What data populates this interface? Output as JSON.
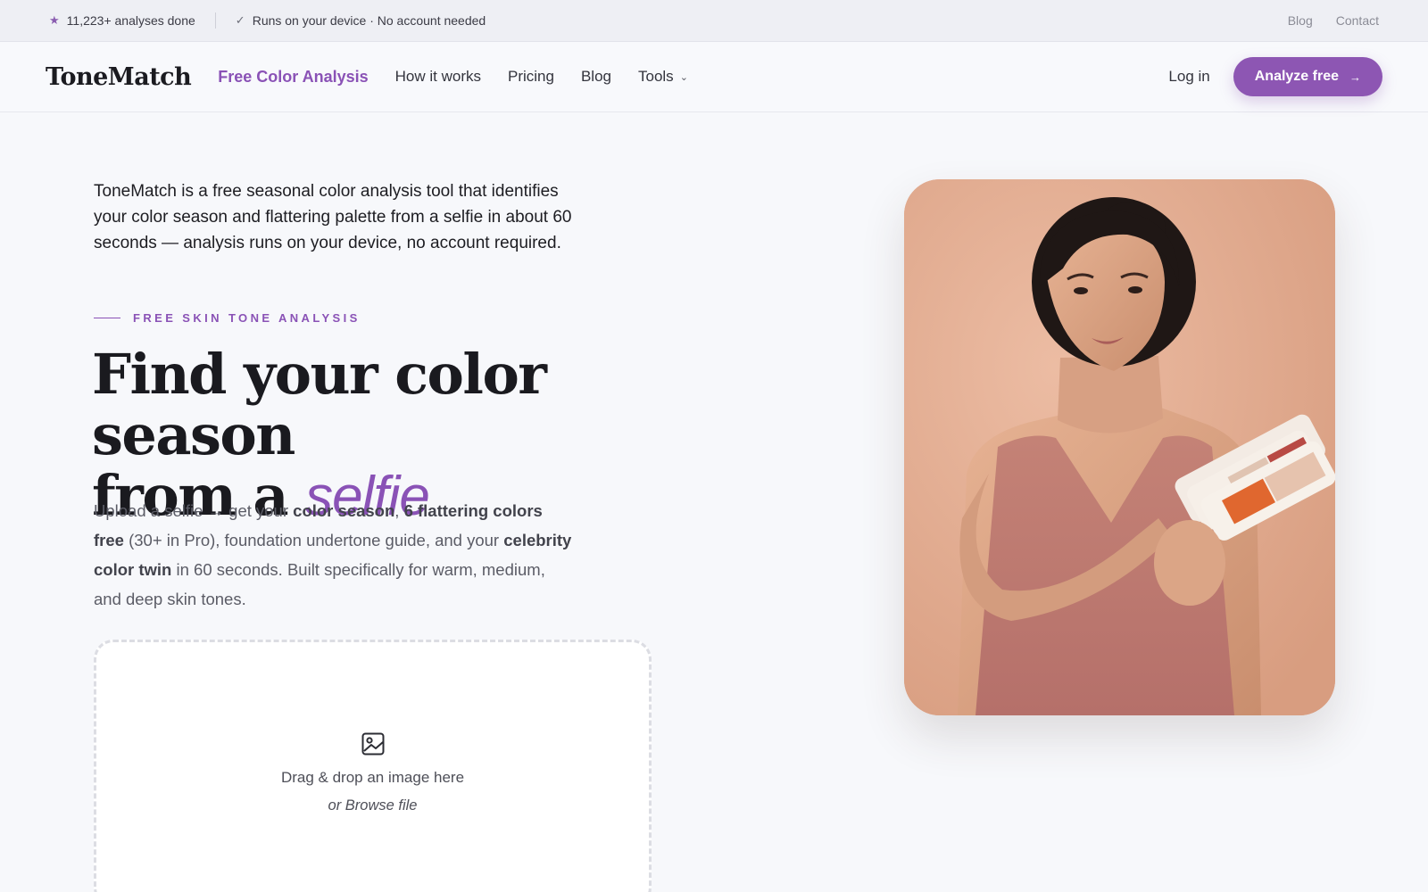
{
  "topbar": {
    "analyses": "11,223+ analyses done",
    "privacy": "Runs on your device · No account needed",
    "links": [
      "Blog",
      "Contact"
    ]
  },
  "nav": {
    "logo": "ToneMatch",
    "active_link": "Free Color Analysis",
    "links": [
      "How it works",
      "Pricing",
      "Blog"
    ],
    "tools": "Tools",
    "login": "Log in",
    "cta": "Analyze free"
  },
  "hero": {
    "intro": "ToneMatch is a free seasonal color analysis tool that identifies your color season and flattering palette from a selfie in about 60 seconds — analysis runs on your device, no account required.",
    "eyebrow": "FREE SKIN TONE ANALYSIS",
    "headline_line1": "Find your color season",
    "headline_line2_prefix": "from a ",
    "headline_accent": "selfie",
    "sub": {
      "p1": "Upload a selfie → get your ",
      "b1": "color season",
      "p2": ", ",
      "b2": "6 flattering colors free",
      "p3": " (30+ in Pro), foundation undertone guide, and your ",
      "b3": "celebrity color twin",
      "p4": " in 60 seconds. Built specifically for warm, medium, and deep skin tones."
    }
  },
  "upload": {
    "drag_text": "Drag & drop an image here",
    "browse_text": "or Browse file"
  },
  "colors": {
    "accent": "#8a52b6",
    "background": "#f7f8fb",
    "hero_bg": "#e2a98e"
  }
}
